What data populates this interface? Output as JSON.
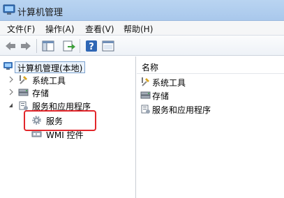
{
  "window": {
    "title": "计算机管理"
  },
  "menu": {
    "items": [
      "文件(F)",
      "操作(A)",
      "查看(V)",
      "帮助(H)"
    ]
  },
  "toolbar": {
    "buttons": [
      "back-icon",
      "forward-icon",
      "show-hide-tree-icon",
      "export-icon",
      "help-icon",
      "properties-icon"
    ]
  },
  "tree": {
    "root": "计算机管理(本地)",
    "items": [
      "系统工具",
      "存储",
      "服务和应用程序"
    ],
    "children": [
      "服务",
      "WMI 控件"
    ]
  },
  "list": {
    "column": "名称",
    "items": [
      "系统工具",
      "存储",
      "服务和应用程序"
    ]
  },
  "colors": {
    "titlebar": "#b9d4f1",
    "highlight_box": "#e2262b",
    "selection_border": "#7da2ce"
  }
}
